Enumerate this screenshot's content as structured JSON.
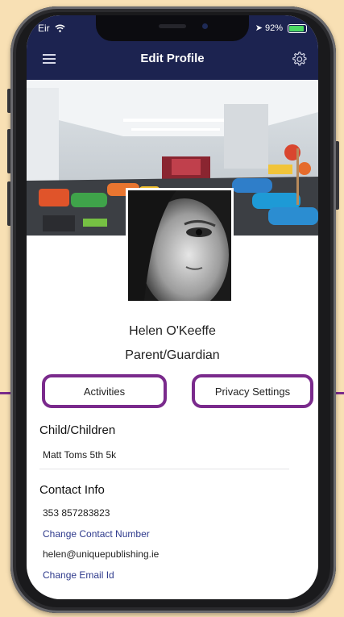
{
  "status": {
    "carrier": "Eir",
    "battery": "92%",
    "battery_level": 0.92
  },
  "header": {
    "title": "Edit Profile"
  },
  "profile": {
    "name": "Helen O'Keeffe",
    "role": "Parent/Guardian"
  },
  "actions": {
    "activities_label": "Activities",
    "privacy_label": "Privacy Settings"
  },
  "children": {
    "heading": "Child/Children",
    "items": [
      "Matt Toms 5th 5k"
    ]
  },
  "contact": {
    "heading": "Contact Info",
    "phone": "353 857283823",
    "change_phone_label": "Change Contact Number",
    "email": "helen@uniquepublishing.ie",
    "change_email_label": "Change Email Id"
  },
  "colors": {
    "header_bg": "#1c2350",
    "callout": "#7a2a8c",
    "link": "#2e3a8c",
    "background": "#f8e0b4"
  },
  "icons": {
    "menu": "hamburger-menu-icon",
    "settings": "gear-icon"
  }
}
